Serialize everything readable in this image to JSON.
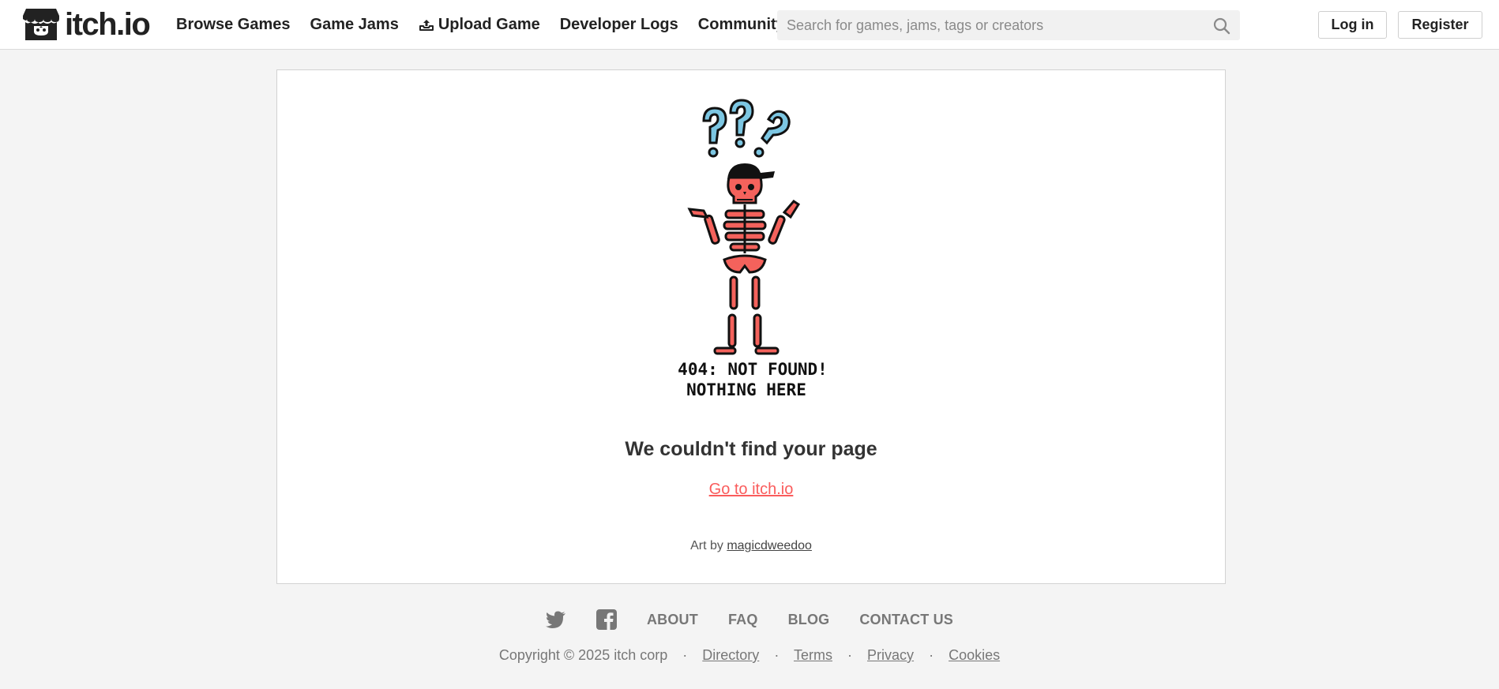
{
  "header": {
    "logo_text": "itch.io",
    "nav": [
      {
        "label": "Browse Games"
      },
      {
        "label": "Game Jams"
      },
      {
        "label": "Upload Game",
        "icon": "upload-icon"
      },
      {
        "label": "Developer Logs"
      },
      {
        "label": "Community"
      }
    ],
    "search_placeholder": "Search for games, jams, tags or creators",
    "search_icon": "search-icon",
    "login_label": "Log in",
    "register_label": "Register"
  },
  "main": {
    "illustration": {
      "line1": "404: NOT FOUND!",
      "line2": "NOTHING HERE"
    },
    "title": "We couldn't find your page",
    "home_link": "Go to itch.io",
    "credit_prefix": "Art by",
    "credit_author": "magicdweedoo"
  },
  "footer": {
    "social": [
      "twitter-icon",
      "facebook-icon"
    ],
    "links": [
      "ABOUT",
      "FAQ",
      "BLOG",
      "CONTACT US"
    ],
    "copyright": "Copyright © 2025 itch corp",
    "bottom_links": [
      "Directory",
      "Terms",
      "Privacy",
      "Cookies"
    ],
    "separator": "·"
  },
  "colors": {
    "accent": "#fa5c5c",
    "skeleton_red": "#f4625c",
    "question_blue": "#7cc6e2",
    "ink": "#111111"
  }
}
